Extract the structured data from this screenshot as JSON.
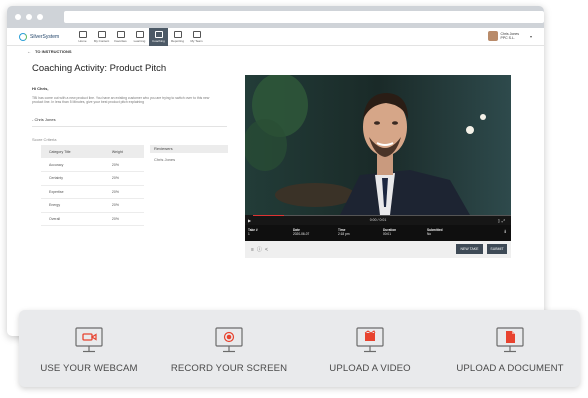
{
  "app": {
    "brand": "SilverSystem",
    "nav": [
      {
        "label": "Home",
        "icon": "home-icon"
      },
      {
        "label": "My Content",
        "icon": "folder-icon"
      },
      {
        "label": "Favorites",
        "icon": "heart-icon"
      },
      {
        "label": "Learning",
        "icon": "graduation-cap-icon"
      },
      {
        "label": "Coaching",
        "icon": "coaching-icon",
        "active": true
      },
      {
        "label": "Reporting",
        "icon": "bar-chart-icon"
      },
      {
        "label": "My Team",
        "icon": "team-icon"
      }
    ],
    "user": {
      "name": "Chris Jones",
      "subtitle": "PPC S.L."
    }
  },
  "breadcrumb": {
    "back_label": "TO INSTRUCTIONS"
  },
  "activity": {
    "title": "Coaching Activity: Product Pitch",
    "greeting": "Hi Chris,",
    "message": "TBI has come out with a new product line. You have an existing customer who you are trying to switch over to this new product line. In less than 5 Minutes, give your best product pitch explaining",
    "signature": "- Chris Jones",
    "criteria_label": "Score Criteria",
    "criteria_headers": [
      "Category Title",
      "Weight"
    ],
    "criteria": [
      {
        "category": "Accuracy",
        "weight": "20%"
      },
      {
        "category": "Certainty",
        "weight": "20%"
      },
      {
        "category": "Expertise",
        "weight": "20%"
      },
      {
        "category": "Energy",
        "weight": "20%"
      },
      {
        "category": "Overall",
        "weight": "20%"
      }
    ],
    "reviewers_label": "Reviewers",
    "reviewers": [
      "Chris Jones"
    ]
  },
  "video": {
    "time": "0:00 / 0:01",
    "progress": 0.12,
    "meta": [
      {
        "label": "Take #",
        "value": "1"
      },
      {
        "label": "Date",
        "value": "2020-06-07"
      },
      {
        "label": "Time",
        "value": "2:18 pm"
      },
      {
        "label": "Duration",
        "value": "00:01"
      },
      {
        "label": "Submitted",
        "value": "No"
      }
    ],
    "new_take_label": "NEW TAKE",
    "submit_label": "SUBMIT"
  },
  "options": [
    {
      "label": "USE YOUR WEBCAM",
      "icon": "webcam-icon",
      "accent": "#e8432f"
    },
    {
      "label": "RECORD YOUR SCREEN",
      "icon": "record-screen-icon",
      "accent": "#e8432f"
    },
    {
      "label": "UPLOAD A VIDEO",
      "icon": "upload-video-icon",
      "accent": "#e8432f"
    },
    {
      "label": "UPLOAD A DOCUMENT",
      "icon": "upload-document-icon",
      "accent": "#e8432f"
    }
  ],
  "colors": {
    "accent": "#e8432f",
    "nav_active": "#4c5966",
    "button": "#3e4a56"
  }
}
